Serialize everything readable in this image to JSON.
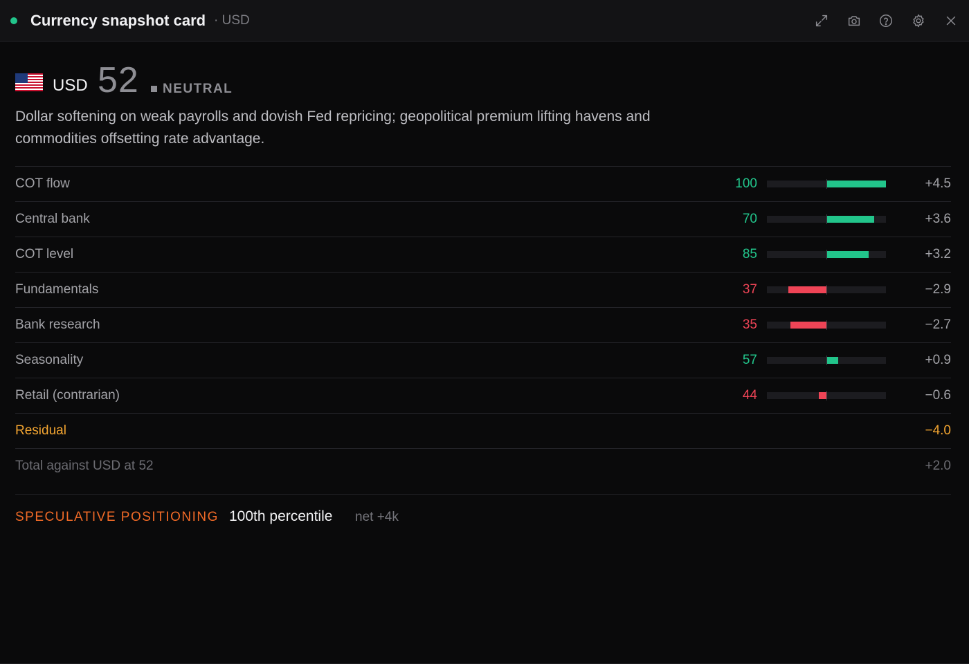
{
  "window": {
    "title": "Currency snapshot card",
    "subtitle": "· USD",
    "status_color": "#22c58b",
    "toolbar_icons": [
      "expand-icon",
      "camera-icon",
      "help-icon",
      "gear-icon",
      "close-icon"
    ]
  },
  "header": {
    "currency": "USD",
    "flag": "us-flag",
    "score": "52",
    "stance": "NEUTRAL",
    "summary": "Dollar softening on weak payrolls and dovish Fed repricing; geopolitical premium lifting havens and commodities offsetting rate advantage."
  },
  "factors": [
    {
      "label": "COT flow",
      "score": "100",
      "score_value": 100,
      "contribution": "+4.5",
      "contribution_value": 4.5
    },
    {
      "label": "Central bank",
      "score": "70",
      "score_value": 70,
      "contribution": "+3.6",
      "contribution_value": 3.6
    },
    {
      "label": "COT level",
      "score": "85",
      "score_value": 85,
      "contribution": "+3.2",
      "contribution_value": 3.2
    },
    {
      "label": "Fundamentals",
      "score": "37",
      "score_value": 37,
      "contribution": "−2.9",
      "contribution_value": -2.9
    },
    {
      "label": "Bank research",
      "score": "35",
      "score_value": 35,
      "contribution": "−2.7",
      "contribution_value": -2.7
    },
    {
      "label": "Seasonality",
      "score": "57",
      "score_value": 57,
      "contribution": "+0.9",
      "contribution_value": 0.9
    },
    {
      "label": "Retail (contrarian)",
      "score": "44",
      "score_value": 44,
      "contribution": "−0.6",
      "contribution_value": -0.6
    }
  ],
  "residual": {
    "label": "Residual",
    "contribution": "−4.0"
  },
  "total": {
    "label": "Total against USD at 52",
    "contribution": "+2.0"
  },
  "positioning": {
    "label": "SPECULATIVE POSITIONING",
    "percentile": "100th percentile",
    "net": "net +4k"
  },
  "colors": {
    "positive": "#22c58b",
    "negative": "#ef4456",
    "residual": "#f3a531",
    "positioning_label": "#f06a27"
  }
}
